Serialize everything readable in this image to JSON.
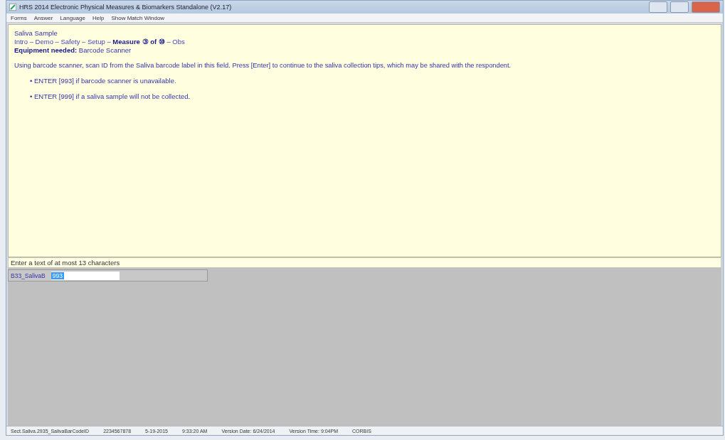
{
  "window": {
    "title": "HRS 2014 Electronic Physical Measures & Biomarkers Standalone (V2.17)"
  },
  "menu": [
    "Forms",
    "Answer",
    "Language",
    "Help",
    "Show Match Window"
  ],
  "question": {
    "title": "Saliva Sample",
    "breadcrumb": "Intro – Demo – Safety – Setup – **Measure ③ of ⑩** – Obs",
    "equipment_label": "Equipment needed:",
    "equipment": "Barcode Scanner",
    "instruction": "Using barcode scanner, scan ID from the Saliva barcode label in this field. Press [Enter] to continue to the saliva collection tips, which may be shared with the respondent.",
    "bullets": [
      "• ENTER [993] if barcode scanner is unavailable.",
      "• ENTER [999] if a saliva sample will not be collected."
    ]
  },
  "hint": "Enter a text of at most 13 characters",
  "field": {
    "label": "B33_SalivaB",
    "value": "993"
  },
  "status_bar": [
    "Sect.Saliva.2935_SalivaBarCodeID",
    "2234567878",
    "5-19-2015",
    "9:33:20 AM",
    "Version Date: 6/24/2014",
    "Version Time: 9:04PM",
    "CORBIS"
  ]
}
